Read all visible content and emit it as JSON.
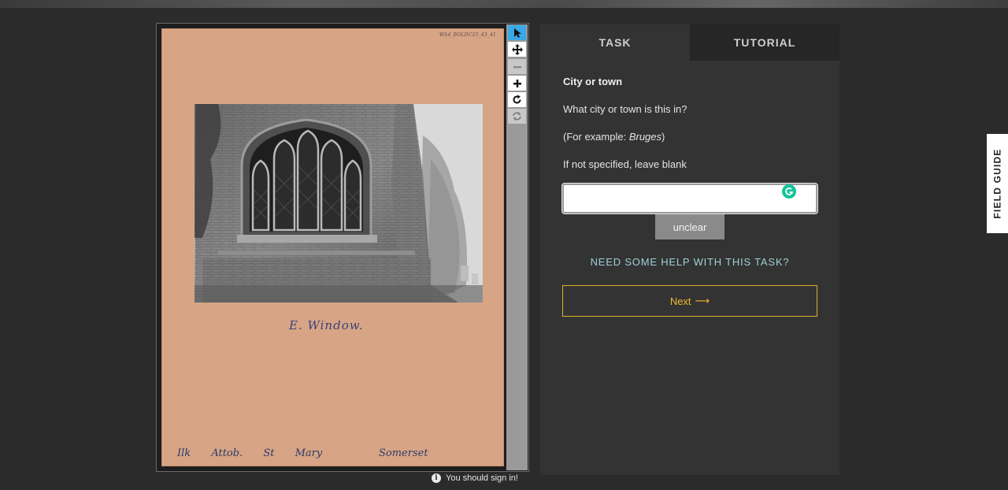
{
  "subject": {
    "card_reference": "WA4_BOLDC25_43_41",
    "caption_handwriting": "E. Window.",
    "footer_handwriting": [
      "Ilk",
      "Attob.",
      "St",
      "Mary"
    ],
    "footer_county": "Somerset"
  },
  "toolbar": {
    "tools": [
      "pointer-icon",
      "move-icon",
      "zoom-out-icon",
      "zoom-in-icon",
      "rotate-icon",
      "reset-icon"
    ]
  },
  "signin": {
    "text": "You should sign in!"
  },
  "tabs": {
    "task": "TASK",
    "tutorial": "TUTORIAL"
  },
  "task": {
    "title": "City or town",
    "question": "What city or town is this in?",
    "example_prefix": "(For example: ",
    "example_value": "Bruges",
    "example_suffix": ")",
    "instruction": "If not specified, leave blank",
    "answer_value": "",
    "unclear_label": "unclear",
    "help_label": "NEED SOME HELP WITH THIS TASK?",
    "next_label": "Next",
    "next_arrow": "⟶"
  },
  "field_guide": {
    "label": "FIELD GUIDE"
  },
  "colors": {
    "accent_next": "#f0b92a",
    "help_link": "#9ed0d6",
    "active_tool": "#3aa8e6"
  }
}
